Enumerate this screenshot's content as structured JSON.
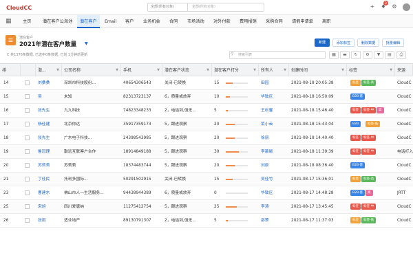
{
  "app": {
    "name": "CloudCC"
  },
  "topbar": {
    "search_scope": "全部(所有对象)",
    "search_placeholder": "全部(所有对象)",
    "icons": [
      "plus-icon",
      "bell-icon",
      "settings-icon",
      "help-icon"
    ],
    "notification_count": "8"
  },
  "nav": {
    "items": [
      "主页",
      "潜在客户公海池",
      "潜在客户",
      "Email",
      "客户",
      "业务机会",
      "合同",
      "市场活动",
      "对外付款",
      "费用报销",
      "采购合同",
      "请假申请单",
      "离职"
    ],
    "active": "潜在客户"
  },
  "header": {
    "sub_label": "潜在客户",
    "title": "2021年潜在客户数量",
    "info": "C 共1376条数据, 已选中0条数据, 已划 1分钟前更新",
    "buttons": [
      "新建",
      "添加标签",
      "删除数据",
      "批量编辑"
    ],
    "search_placeholder": "搜索列表"
  },
  "table": {
    "columns": [
      "排",
      "潜...",
      "公司名称",
      "手机",
      "潜在客户状态",
      "潜在客户打分",
      "所有人",
      "创建时间",
      "标签",
      "来源"
    ],
    "rows": [
      {
        "num": "14",
        "name": "刘桑桑",
        "company": "深圳市科技股份...",
        "phone": "40654306543",
        "status": "关闭-已转换",
        "score": "15",
        "score_pct": 0.3,
        "owner": "田园",
        "created": "2021-08-18 20:05:38",
        "tags": [
          {
            "t": "标签",
            "c": "orange"
          },
          {
            "t": "标签-高",
            "c": "green"
          }
        ],
        "source": "CloudC"
      },
      {
        "num": "15",
        "name": "吴",
        "company": "未知",
        "phone": "82313723137",
        "status": "6，质量或放弃",
        "score": "10",
        "score_pct": 0.2,
        "owner": "华致区",
        "created": "2021-08-18 16:50:09",
        "tags": [
          {
            "t": "B2B-客",
            "c": "blue"
          }
        ],
        "source": "CloudC"
      },
      {
        "num": "16",
        "name": "张先生",
        "company": "九九科技",
        "phone": "74823348233",
        "status": "2，电话到,但无...",
        "score": "5",
        "score_pct": 0.1,
        "owner": "王松馨",
        "created": "2021-08-18 15:46:40",
        "tags": [
          {
            "t": "标签",
            "c": "red"
          },
          {
            "t": "标签-中",
            "c": "red"
          },
          {
            "t": "高",
            "c": "pink"
          }
        ],
        "source": "CloudC"
      },
      {
        "num": "17",
        "name": "杨佳建",
        "company": "北京你达",
        "phone": "35917359173",
        "status": "5，跟进观察",
        "score": "20",
        "score_pct": 0.4,
        "owner": "菜小云",
        "created": "2021-08-18 15:43:04",
        "tags": [
          {
            "t": "B2B",
            "c": "blue"
          },
          {
            "t": "标签-低",
            "c": "orange"
          }
        ],
        "source": "CloudC"
      },
      {
        "num": "18",
        "name": "张先生",
        "company": "广东电子科技...",
        "phone": "24398543985",
        "status": "5，跟进观察",
        "score": "20",
        "score_pct": 0.4,
        "owner": "徐丽",
        "created": "2021-08-18 14:40:40",
        "tags": [
          {
            "t": "标签",
            "c": "red"
          },
          {
            "t": "标签-中",
            "c": "red"
          }
        ],
        "source": "CloudC"
      },
      {
        "num": "19",
        "name": "鲁冠理",
        "company": "勤远互联客户合作",
        "phone": "18914849188",
        "status": "5，跟进观察",
        "score": "30",
        "score_pct": 0.6,
        "owner": "李慕颖",
        "created": "2021-08-18 11:39:39",
        "tags": [
          {
            "t": "标签",
            "c": "red"
          },
          {
            "t": "标签-中",
            "c": "red"
          }
        ],
        "source": "电话打入"
      },
      {
        "num": "20",
        "name": "苏莉莉",
        "company": "苏莉莉",
        "phone": "18374483744",
        "status": "5，跟进观察",
        "score": "20",
        "score_pct": 0.4,
        "owner": "刘原",
        "created": "2021-08-18 08:36:40",
        "tags": [
          {
            "t": "B2B-客",
            "c": "blue"
          }
        ],
        "source": "CloudC"
      },
      {
        "num": "21",
        "name": "丁佳民",
        "company": "托利多国际...",
        "phone": "50291502915",
        "status": "关闭-已转换",
        "score": "15",
        "score_pct": 0.3,
        "owner": "吴佳竹",
        "created": "2021-08-17 15:36:01",
        "tags": [
          {
            "t": "标签",
            "c": "orange"
          },
          {
            "t": "标签-高",
            "c": "green"
          }
        ],
        "source": "CloudC"
      },
      {
        "num": "23",
        "name": "曹建东",
        "company": "佛山市人一生活服务...",
        "phone": "94438944389",
        "status": "6，质量或放弃",
        "score": "0",
        "score_pct": 0.0,
        "owner": "华致区",
        "created": "2021-08-17 14:48:28",
        "tags": [
          {
            "t": "B2B-客",
            "c": "blue"
          },
          {
            "t": "高",
            "c": "pink"
          }
        ],
        "source": "JRTT"
      },
      {
        "num": "25",
        "name": "宋旭",
        "company": "四川爱唐纳",
        "phone": "11275412754",
        "status": "5，跟进观察",
        "score": "25",
        "score_pct": 0.5,
        "owner": "李涛",
        "created": "2021-08-17 13:45:45",
        "tags": [
          {
            "t": "标签",
            "c": "red"
          },
          {
            "t": "标签-中",
            "c": "red"
          }
        ],
        "source": "CloudC"
      },
      {
        "num": "26",
        "name": "张雨",
        "company": "适业地产",
        "phone": "89130791307",
        "status": "2，电话到,但无...",
        "score": "5",
        "score_pct": 0.1,
        "owner": "邵翠",
        "created": "2021-08-17 11:37:03",
        "tags": [
          {
            "t": "标签",
            "c": "orange"
          },
          {
            "t": "标签-低",
            "c": "green"
          }
        ],
        "source": "CloudC"
      }
    ]
  },
  "colors": {
    "accent": "#1a66c9",
    "brand": "#c0392b",
    "score_bar": "#f08a4b"
  }
}
